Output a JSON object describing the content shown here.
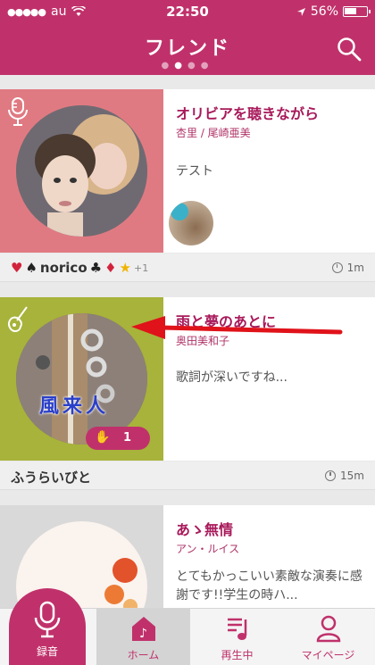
{
  "status_bar": {
    "carrier": "au",
    "time": "22:50",
    "battery": "56%",
    "signal_dots": "●●●●●"
  },
  "header": {
    "title": "フレンド",
    "search_icon": "search-icon"
  },
  "feed": [
    {
      "title": "オリビアを聴きながら",
      "artist": "杏里 / 尾崎亜美",
      "comment": "テスト",
      "category_icon": "microphone-icon",
      "art_bg": "#e07a82",
      "footer_user": "norico",
      "reactions_extra": "+1",
      "time_ago": "1m"
    },
    {
      "title": "雨と夢のあとに",
      "artist": "奥田美和子",
      "comment": "歌詞が深いですね...",
      "category_icon": "guitar-icon",
      "art_bg": "#a7b33a",
      "listen_count": "1",
      "footer_user": "ふうらいびと",
      "time_ago": "15m",
      "art_text": "風来人"
    },
    {
      "title": "あゝ無情",
      "artist": "アン・ルイス",
      "comment": "とてもかっこいい素敵な演奏に感謝です!!学生の時ハ...",
      "art_bg": "#d9d9d9"
    }
  ],
  "tabs": {
    "record": "録音",
    "home": "ホーム",
    "playing": "再生中",
    "mypage": "マイページ"
  },
  "colors": {
    "brand": "#c0316b",
    "title": "#a8195a"
  }
}
